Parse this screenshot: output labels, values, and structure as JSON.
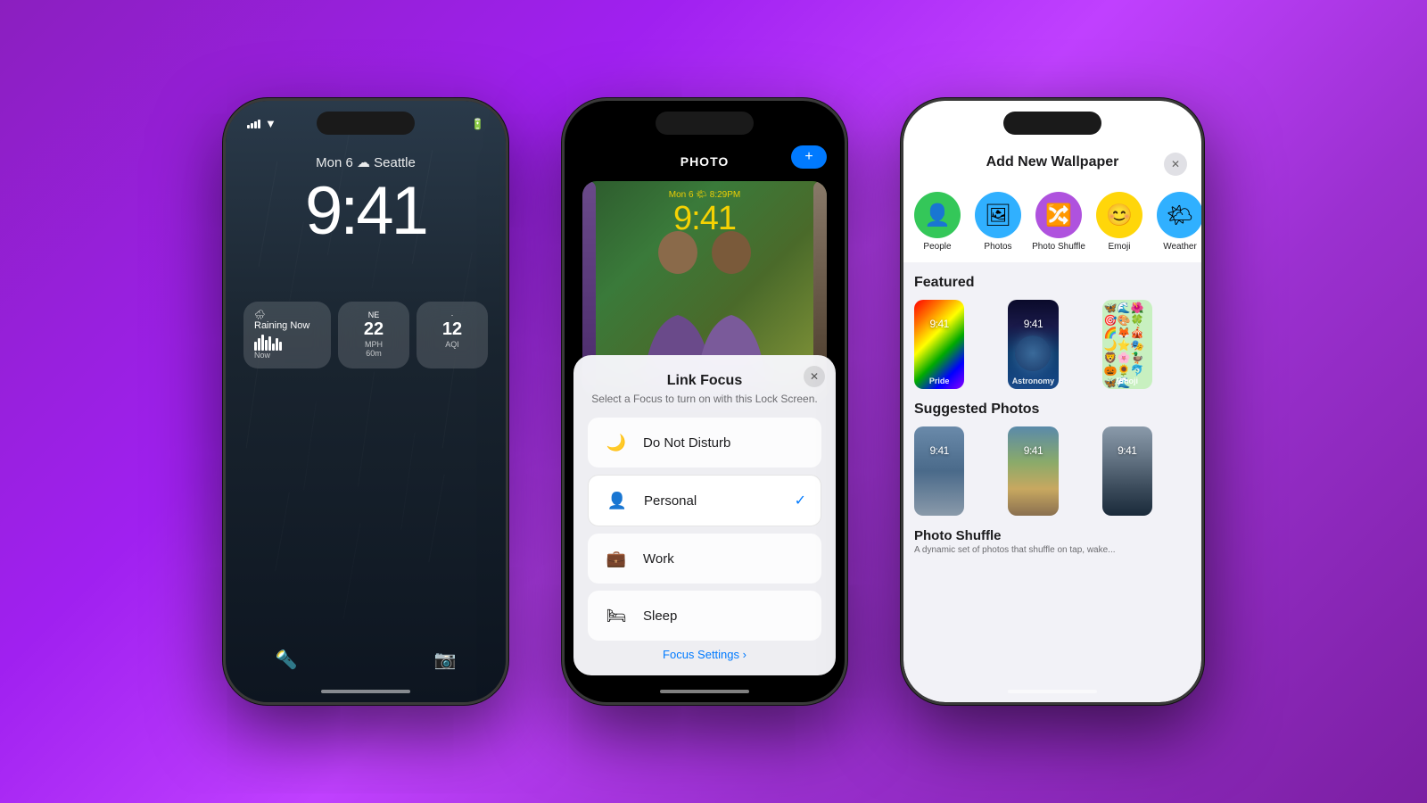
{
  "background": {
    "gradient": "purple"
  },
  "phone1": {
    "type": "lock_screen",
    "status": {
      "signal": "●●●●",
      "wifi": "wifi",
      "battery": "battery"
    },
    "date": "Mon 6 ☁ Seattle",
    "time": "9:41",
    "weather_label": "Raining Now",
    "widgets": [
      {
        "icon": "🌧",
        "label": "Raining Now",
        "sub": "Now",
        "type": "weather"
      },
      {
        "icon": "NE",
        "value": "22",
        "unit": "MPH",
        "sub": "60m",
        "type": "wind"
      },
      {
        "icon": "",
        "value": "12",
        "unit": "AQI",
        "type": "aqi"
      }
    ],
    "bottom_icons": [
      "flashlight",
      "camera"
    ]
  },
  "phone2": {
    "type": "photo_focus",
    "header_label": "PHOTO",
    "add_button": "+",
    "photo_date": "Mon 6 🌤 8:29PM",
    "photo_time": "9:41",
    "link_focus": {
      "title": "Link Focus",
      "subtitle": "Select a Focus to turn on with this Lock Screen.",
      "items": [
        {
          "id": "do_not_disturb",
          "icon": "🌙",
          "label": "Do Not Disturb",
          "selected": false
        },
        {
          "id": "personal",
          "icon": "👤",
          "label": "Personal",
          "selected": true
        },
        {
          "id": "work",
          "icon": "💼",
          "label": "Work",
          "selected": false
        },
        {
          "id": "sleep",
          "icon": "🛏",
          "label": "Sleep",
          "selected": false
        }
      ],
      "settings_link": "Focus Settings ›"
    }
  },
  "phone3": {
    "type": "add_wallpaper",
    "header_title": "Add New Wallpaper",
    "close_button": "✕",
    "wallpaper_types": [
      {
        "id": "people",
        "icon": "👤",
        "label": "People",
        "bg": "#34C759"
      },
      {
        "id": "photos",
        "icon": "🖼",
        "label": "Photos",
        "bg": "#30B0FF"
      },
      {
        "id": "photo_shuffle",
        "icon": "🔀",
        "label": "Photo Shuffle",
        "bg": "#AF52DE"
      },
      {
        "id": "emoji",
        "icon": "😊",
        "label": "Emoji",
        "bg": "#FFD60A"
      },
      {
        "id": "weather",
        "icon": "🌤",
        "label": "Weather",
        "bg": "#30B0FF"
      }
    ],
    "featured_title": "Featured",
    "featured_items": [
      {
        "id": "pride",
        "label": "Pride",
        "style": "pride"
      },
      {
        "id": "astronomy",
        "label": "Astronomy",
        "style": "astronomy"
      },
      {
        "id": "emoji",
        "label": "Emoji",
        "style": "emoji"
      }
    ],
    "suggested_photos_title": "Suggested Photos",
    "suggested_items": [
      {
        "id": "bridge",
        "label": "",
        "style": "bridge"
      },
      {
        "id": "desert",
        "label": "",
        "style": "desert"
      },
      {
        "id": "city",
        "label": "",
        "style": "city"
      }
    ],
    "photo_shuffle_section": {
      "title": "Photo Shuffle",
      "description": "A dynamic set of photos that shuffle on tap, wake..."
    }
  }
}
